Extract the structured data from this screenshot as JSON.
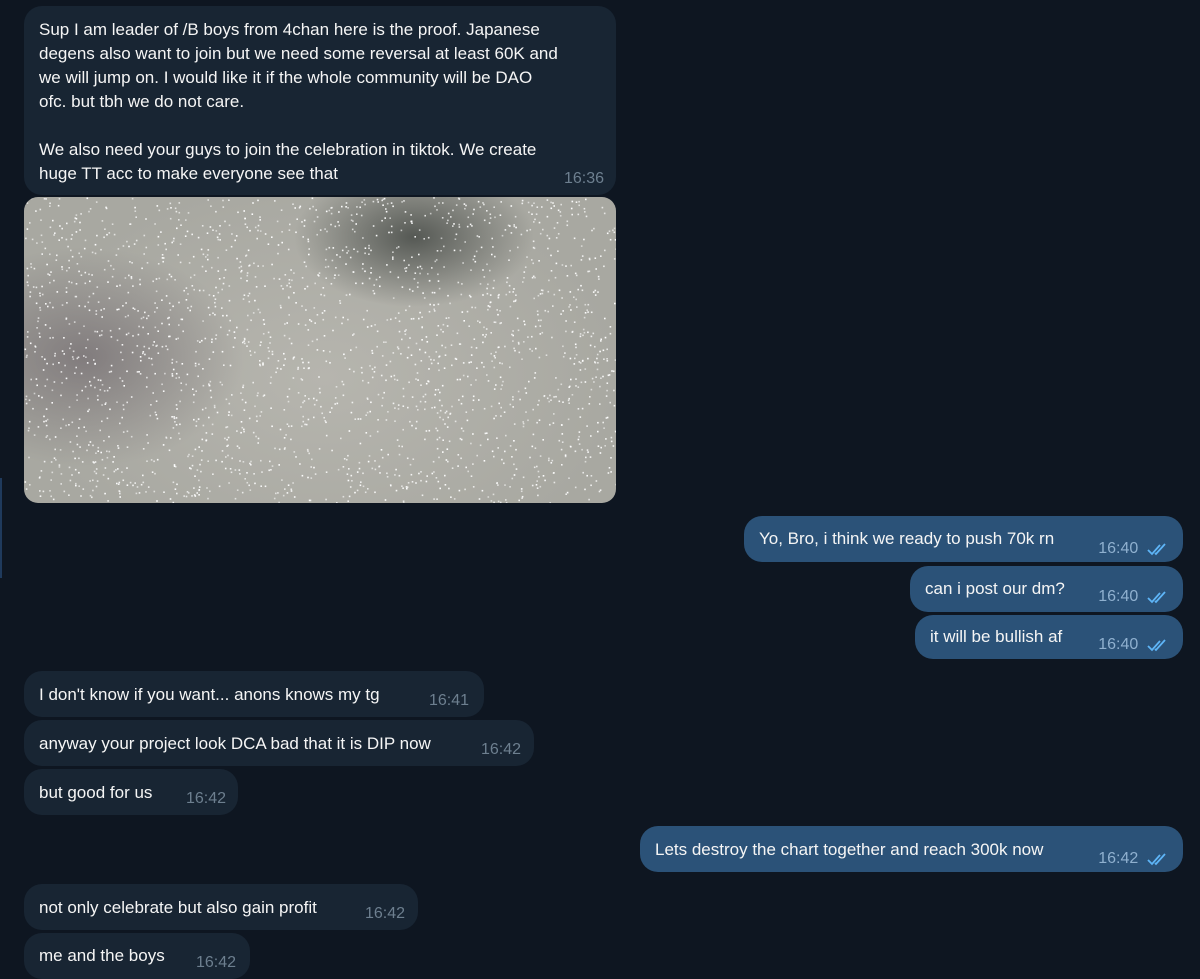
{
  "colors": {
    "background": "#0e1621",
    "incoming_bubble": "#182533",
    "outgoing_bubble": "#2b5278",
    "read_ticks": "#5eb5f7"
  },
  "messages": [
    {
      "direction": "incoming",
      "text": "Sup I am leader of /B boys from 4chan here is the proof. Japanese\ndegens also want to join but we need some reversal at least 60K and\nwe will jump on. I would like it if the whole community will be DAO\nofc. but tbh we do not care.\n\nWe also need your guys to join the celebration in tiktok. We create\nhuge TT acc to make everyone see that",
      "time": "16:36"
    },
    {
      "direction": "incoming",
      "type": "photo",
      "description": "blurred-photo"
    },
    {
      "direction": "outgoing",
      "text": "Yo, Bro, i think we ready to push 70k rn",
      "time": "16:40",
      "status": "read"
    },
    {
      "direction": "outgoing",
      "text": "can i post our dm?",
      "time": "16:40",
      "status": "read"
    },
    {
      "direction": "outgoing",
      "text": "it will be bullish af",
      "time": "16:40",
      "status": "read"
    },
    {
      "direction": "incoming",
      "text": "I don't know if you want... anons knows my tg",
      "time": "16:41"
    },
    {
      "direction": "incoming",
      "text": "anyway your project look DCA bad that it is DIP now",
      "time": "16:42"
    },
    {
      "direction": "incoming",
      "text": "but good for us",
      "time": "16:42"
    },
    {
      "direction": "outgoing",
      "text": "Lets destroy the chart together and reach 300k now",
      "time": "16:42",
      "status": "read"
    },
    {
      "direction": "incoming",
      "text": "not only celebrate but also gain profit",
      "time": "16:42"
    },
    {
      "direction": "incoming",
      "text": "me and the boys",
      "time": "16:42"
    }
  ]
}
